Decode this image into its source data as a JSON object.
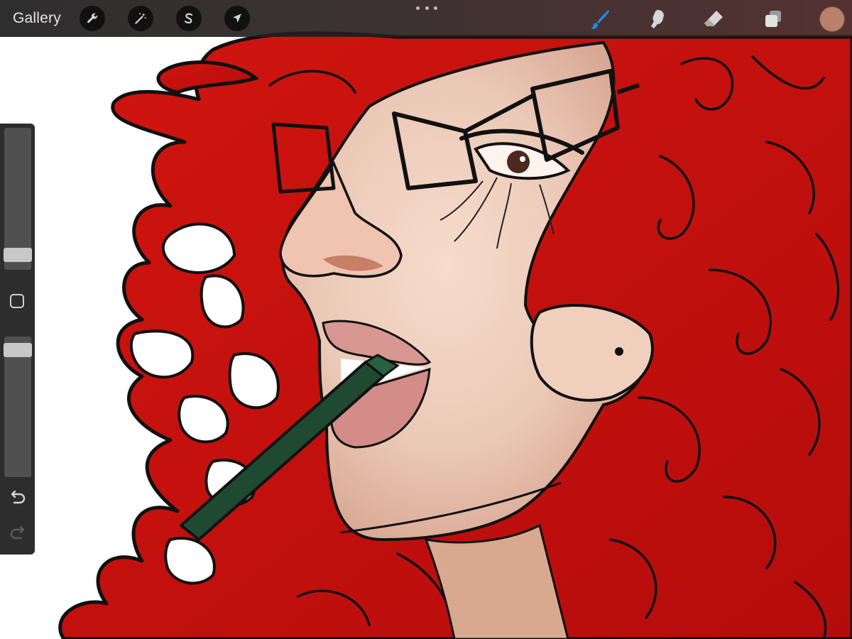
{
  "app": {
    "gallery_label": "Gallery"
  },
  "top_toolbar": {
    "actions_tool": {
      "icon": "wrench-icon"
    },
    "adjustments_tool": {
      "icon": "magic-wand-icon"
    },
    "selection_tool": {
      "icon": "selection-s-icon"
    },
    "transform_tool": {
      "icon": "arrow-cursor-icon"
    },
    "more_menu": {
      "icon": "three-dots-icon"
    },
    "brush_tool": {
      "icon": "brush-icon",
      "active": true
    },
    "smudge_tool": {
      "icon": "smudge-finger-icon"
    },
    "eraser_tool": {
      "icon": "eraser-icon"
    },
    "layers_tool": {
      "icon": "layers-icon"
    },
    "current_color": "#b9806b"
  },
  "sidebar": {
    "brush_size_level": 0.94,
    "opacity_level": 0.95,
    "modify_button": {
      "icon": "square-icon"
    },
    "undo": {
      "icon": "undo-arrow-icon",
      "enabled": true
    },
    "redo": {
      "icon": "redo-arrow-icon",
      "enabled": false
    }
  },
  "colors": {
    "active_brush": "#1e8be6",
    "hair": "#c8100e",
    "skin": "#f1d2c2",
    "crayon": "#1f4a31"
  }
}
